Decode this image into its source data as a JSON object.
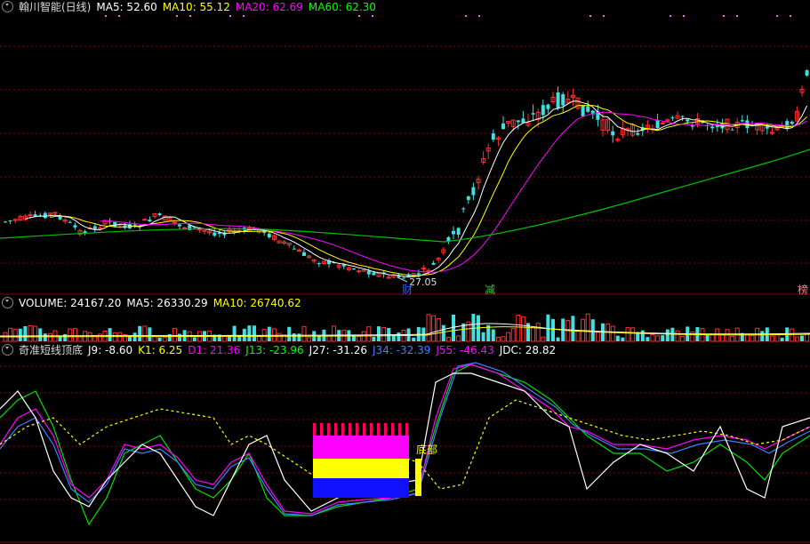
{
  "price_panel": {
    "title": "翰川智能(日线)",
    "ma": [
      {
        "label": "MA5: 52.60",
        "color": "#ffffff"
      },
      {
        "label": "MA10: 55.12",
        "color": "#ffff00"
      },
      {
        "label": "MA20: 62.69",
        "color": "#ff00ff"
      },
      {
        "label": "MA60: 62.30",
        "color": "#00ff00"
      }
    ],
    "low_label": "27.05",
    "markers": [
      {
        "text": "财",
        "color": "#3060ff"
      },
      {
        "text": "减",
        "color": "#40c040"
      },
      {
        "text": "榜",
        "color": "#ff8080"
      }
    ]
  },
  "volume_panel": {
    "items": [
      {
        "label": "VOLUME: 24167.20",
        "color": "#ffffff"
      },
      {
        "label": "MA5: 26330.29",
        "color": "#ffffff"
      },
      {
        "label": "MA10: 26740.62",
        "color": "#ffff00"
      }
    ]
  },
  "indicator_panel": {
    "title": "奇准短线顶底",
    "items": [
      {
        "label": "J9: -8.60",
        "color": "#ffffff"
      },
      {
        "label": "K1: 6.25",
        "color": "#ffff00"
      },
      {
        "label": "D1: 21.36",
        "color": "#ff00ff"
      },
      {
        "label": "J13: -23.96",
        "color": "#00ff00"
      },
      {
        "label": "J27: -31.26",
        "color": "#ffffff"
      },
      {
        "label": "J34: -32.39",
        "color": "#4080ff"
      },
      {
        "label": "J55: -46.43",
        "color": "#ff00ff"
      },
      {
        "label": "JDC: 28.82",
        "color": "#ffffff"
      }
    ],
    "signal_label": "底部"
  },
  "colors": {
    "up": "#ff3030",
    "down": "#40e0e0",
    "grid": "#8a0000",
    "bg": "#000000"
  }
}
